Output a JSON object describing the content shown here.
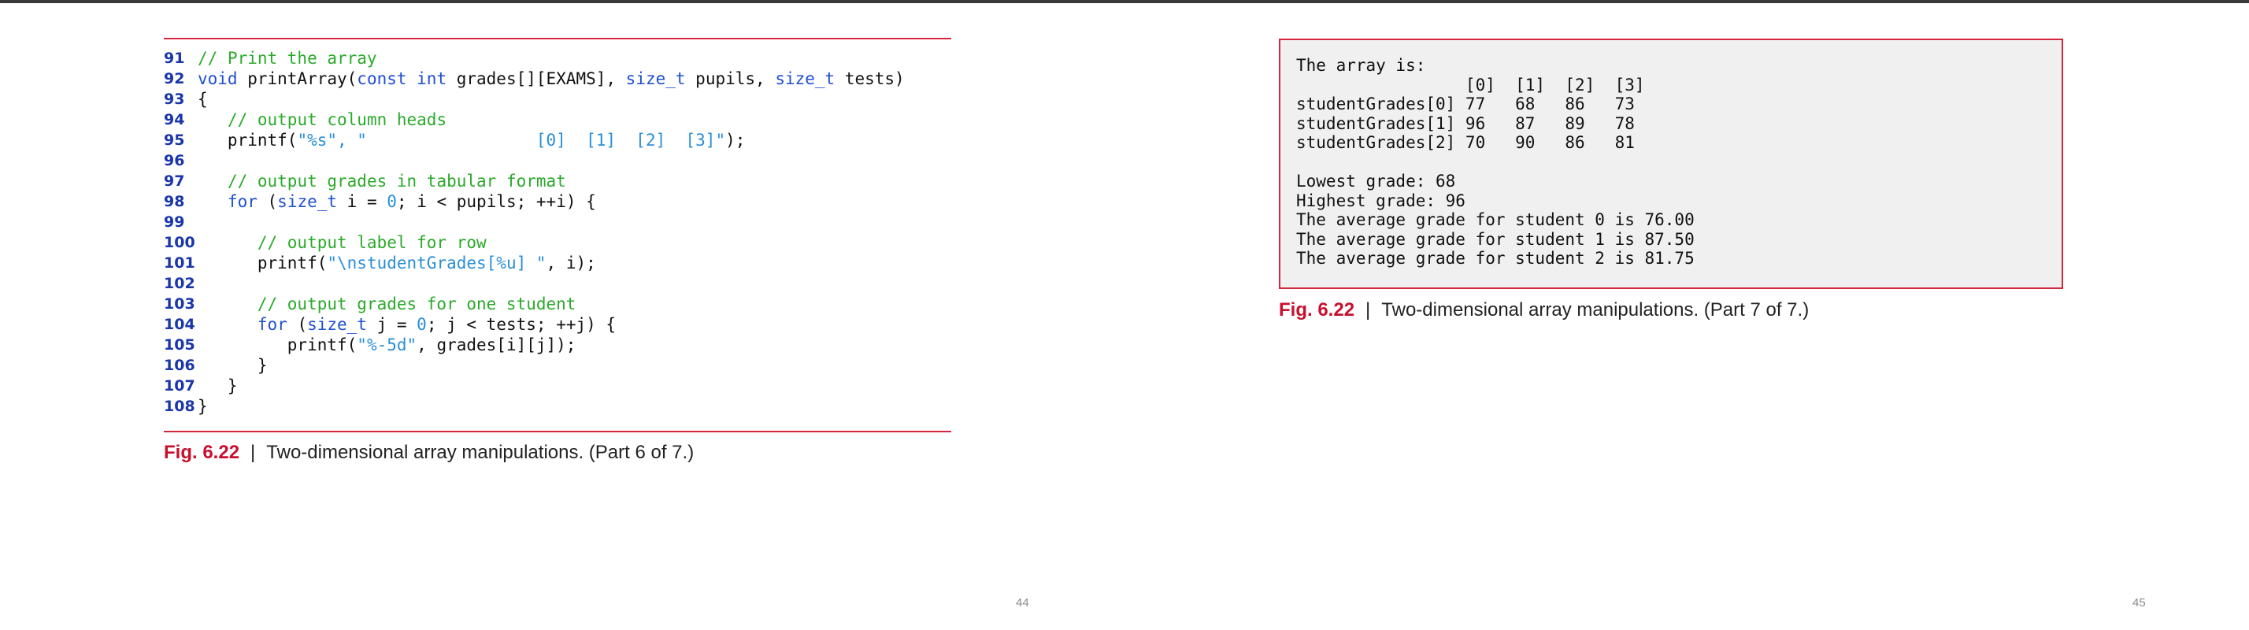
{
  "left_page": {
    "code_lines": [
      {
        "num": "91",
        "segments": [
          {
            "t": "// Print the array",
            "c": "cm"
          }
        ]
      },
      {
        "num": "92",
        "segments": [
          {
            "t": "void",
            "c": "kw"
          },
          {
            "t": " printArray(",
            "c": ""
          },
          {
            "t": "const int",
            "c": "kw"
          },
          {
            "t": " grades[][EXAMS], ",
            "c": ""
          },
          {
            "t": "size_t",
            "c": "kw"
          },
          {
            "t": " pupils, ",
            "c": ""
          },
          {
            "t": "size_t",
            "c": "kw"
          },
          {
            "t": " tests)",
            "c": ""
          }
        ]
      },
      {
        "num": "93",
        "segments": [
          {
            "t": "{",
            "c": ""
          }
        ]
      },
      {
        "num": "94",
        "segments": [
          {
            "t": "   ",
            "c": ""
          },
          {
            "t": "// output column heads",
            "c": "cm"
          }
        ]
      },
      {
        "num": "95",
        "segments": [
          {
            "t": "   printf(",
            "c": ""
          },
          {
            "t": "\"%s\", \"                 [0]  [1]  [2]  [3]\"",
            "c": "str"
          },
          {
            "t": ");",
            "c": ""
          }
        ]
      },
      {
        "num": "96",
        "segments": []
      },
      {
        "num": "97",
        "segments": [
          {
            "t": "   ",
            "c": ""
          },
          {
            "t": "// output grades in tabular format",
            "c": "cm"
          }
        ]
      },
      {
        "num": "98",
        "segments": [
          {
            "t": "   ",
            "c": ""
          },
          {
            "t": "for",
            "c": "kw"
          },
          {
            "t": " (",
            "c": ""
          },
          {
            "t": "size_t",
            "c": "kw"
          },
          {
            "t": " i = ",
            "c": ""
          },
          {
            "t": "0",
            "c": "str"
          },
          {
            "t": "; i < pupils; ++i) {",
            "c": ""
          }
        ]
      },
      {
        "num": "99",
        "segments": []
      },
      {
        "num": "100",
        "segments": [
          {
            "t": "      ",
            "c": ""
          },
          {
            "t": "// output label for row",
            "c": "cm"
          }
        ]
      },
      {
        "num": "101",
        "segments": [
          {
            "t": "      printf(",
            "c": ""
          },
          {
            "t": "\"\\nstudentGrades[%u] \"",
            "c": "str"
          },
          {
            "t": ", i);",
            "c": ""
          }
        ]
      },
      {
        "num": "102",
        "segments": []
      },
      {
        "num": "103",
        "segments": [
          {
            "t": "      ",
            "c": ""
          },
          {
            "t": "// output grades for one student",
            "c": "cm"
          }
        ]
      },
      {
        "num": "104",
        "segments": [
          {
            "t": "      ",
            "c": ""
          },
          {
            "t": "for",
            "c": "kw"
          },
          {
            "t": " (",
            "c": ""
          },
          {
            "t": "size_t",
            "c": "kw"
          },
          {
            "t": " j = ",
            "c": ""
          },
          {
            "t": "0",
            "c": "str"
          },
          {
            "t": "; j < tests; ++j) {",
            "c": ""
          }
        ]
      },
      {
        "num": "105",
        "segments": [
          {
            "t": "         printf(",
            "c": ""
          },
          {
            "t": "\"%-5d\"",
            "c": "str"
          },
          {
            "t": ", grades[i][j]);",
            "c": ""
          }
        ]
      },
      {
        "num": "106",
        "segments": [
          {
            "t": "      }",
            "c": ""
          }
        ]
      },
      {
        "num": "107",
        "segments": [
          {
            "t": "   }",
            "c": ""
          }
        ]
      },
      {
        "num": "108",
        "segments": [
          {
            "t": "}",
            "c": ""
          }
        ]
      }
    ],
    "caption": {
      "label": "Fig. 6.22",
      "separator": "|",
      "text": "Two-dimensional array manipulations. (Part 6 of 7.)"
    },
    "page_number": "44"
  },
  "right_page": {
    "output_lines": [
      "The array is:",
      "                 [0]  [1]  [2]  [3]",
      "studentGrades[0] 77   68   86   73",
      "studentGrades[1] 96   87   89   78",
      "studentGrades[2] 70   90   86   81",
      "",
      "Lowest grade: 68",
      "Highest grade: 96",
      "The average grade for student 0 is 76.00",
      "The average grade for student 1 is 87.50",
      "The average grade for student 2 is 81.75"
    ],
    "caption": {
      "label": "Fig. 6.22",
      "separator": "|",
      "text": "Two-dimensional array manipulations. (Part 7 of 7.)"
    },
    "page_number": "45"
  },
  "colors": {
    "rule": "#d6263e",
    "figure_label": "#c8102e",
    "line_number": "#1a36a8",
    "keyword": "#1f4fd1",
    "string": "#2a8fd6",
    "comment": "#2aaa2a",
    "output_background": "#f0f0f0"
  }
}
